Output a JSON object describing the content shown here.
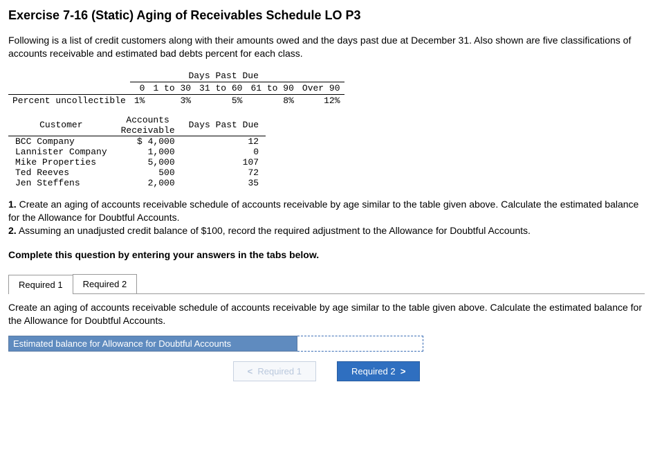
{
  "title": "Exercise 7-16 (Static) Aging of Receivables Schedule LO P3",
  "intro": "Following is a list of credit customers along with their amounts owed and the days past due at December 31. Also shown are five classifications of accounts receivable and estimated bad debts percent for each class.",
  "percent_table": {
    "header": "Days Past Due",
    "row_label": "Percent uncollectible",
    "buckets": [
      "0",
      "1 to 30",
      "31 to 60",
      "61 to 90",
      "Over 90"
    ],
    "percents": [
      "1%",
      "3%",
      "5%",
      "8%",
      "12%"
    ]
  },
  "customers_table": {
    "headers": {
      "customer": "Customer",
      "ar": "Accounts\nReceivable",
      "dpd": "Days Past Due"
    },
    "rows": [
      {
        "name": "BCC Company",
        "ar": "$ 4,000",
        "dpd": "12"
      },
      {
        "name": "Lannister Company",
        "ar": "1,000",
        "dpd": "0"
      },
      {
        "name": "Mike Properties",
        "ar": "5,000",
        "dpd": "107"
      },
      {
        "name": "Ted Reeves",
        "ar": "500",
        "dpd": "72"
      },
      {
        "name": "Jen Steffens",
        "ar": "2,000",
        "dpd": "35"
      }
    ]
  },
  "requirements": {
    "r1": {
      "n": "1.",
      "text": "Create an aging of accounts receivable schedule of accounts receivable by age similar to the table given above. Calculate the estimated balance for the Allowance for Doubtful Accounts."
    },
    "r2": {
      "n": "2.",
      "text": "Assuming an unadjusted credit balance of $100, record the required adjustment to the Allowance for Doubtful Accounts."
    }
  },
  "complete_prompt": "Complete this question by entering your answers in the tabs below.",
  "tabs": {
    "t1": "Required 1",
    "t2": "Required 2"
  },
  "active_tab_desc": "Create an aging of accounts receivable schedule of accounts receivable by age similar to the table given above. Calculate the estimated balance for the Allowance for Doubtful Accounts.",
  "answer_row": {
    "label": "Estimated balance for Allowance for Doubtful Accounts",
    "value": ""
  },
  "nav": {
    "prev": "Required 1",
    "next": "Required 2",
    "left_chev": "<",
    "right_chev": ">"
  },
  "chart_data": {
    "type": "table",
    "percent_uncollectible": {
      "buckets": [
        "0",
        "1 to 30",
        "31 to 60",
        "61 to 90",
        "Over 90"
      ],
      "percent": [
        1,
        3,
        5,
        8,
        12
      ]
    },
    "customers": [
      {
        "customer": "BCC Company",
        "accounts_receivable": 4000,
        "days_past_due": 12
      },
      {
        "customer": "Lannister Company",
        "accounts_receivable": 1000,
        "days_past_due": 0
      },
      {
        "customer": "Mike Properties",
        "accounts_receivable": 5000,
        "days_past_due": 107
      },
      {
        "customer": "Ted Reeves",
        "accounts_receivable": 500,
        "days_past_due": 72
      },
      {
        "customer": "Jen Steffens",
        "accounts_receivable": 2000,
        "days_past_due": 35
      }
    ]
  }
}
